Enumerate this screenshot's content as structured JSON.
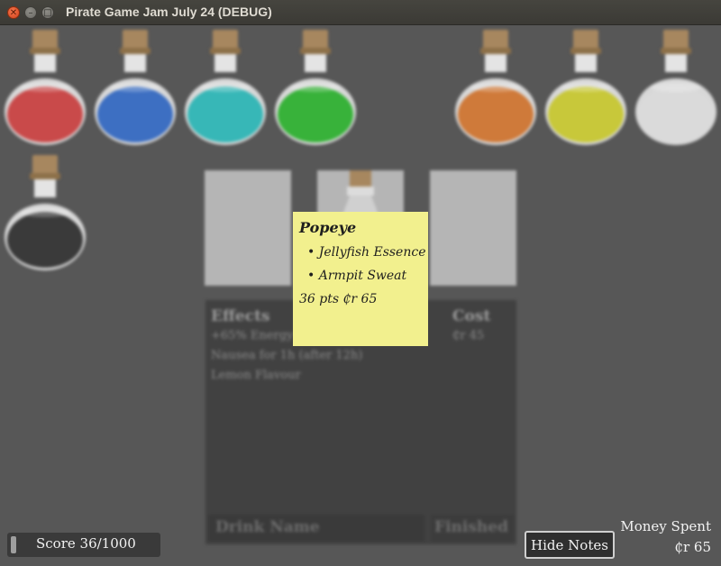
{
  "window": {
    "title": "Pirate Game Jam July 24 (DEBUG)"
  },
  "potions": [
    {
      "name": "red-potion",
      "color": "#c94a4a"
    },
    {
      "name": "blue-potion",
      "color": "#3d6fc2"
    },
    {
      "name": "teal-potion",
      "color": "#37b7b7"
    },
    {
      "name": "green-potion",
      "color": "#38b23a"
    },
    {
      "name": "orange-potion",
      "color": "#cf7a3a"
    },
    {
      "name": "yellow-potion",
      "color": "#c8c83a"
    },
    {
      "name": "white-potion",
      "color": "#dadada"
    },
    {
      "name": "black-potion",
      "color": "#3a3a3a"
    }
  ],
  "panel": {
    "effects_heading": "Effects",
    "effects": [
      "+65% Energy",
      "Nausea for 1h (after 12h)",
      "Lemon Flavour"
    ],
    "cost_heading": "Cost",
    "cost_value": "₵r 45",
    "drink_name_placeholder": "Drink Name",
    "finished_label": "Finished"
  },
  "note": {
    "title": "Popeye",
    "ingredients": [
      "Jellyfish Essence",
      "Armpit Sweat"
    ],
    "footer": "36 pts   ₵r 65"
  },
  "hud": {
    "score": "Score 36/1000",
    "score_progress": 0.036,
    "hide_notes_label": "Hide Notes",
    "money_label": "Money Spent",
    "money_value": "₵r 65"
  }
}
